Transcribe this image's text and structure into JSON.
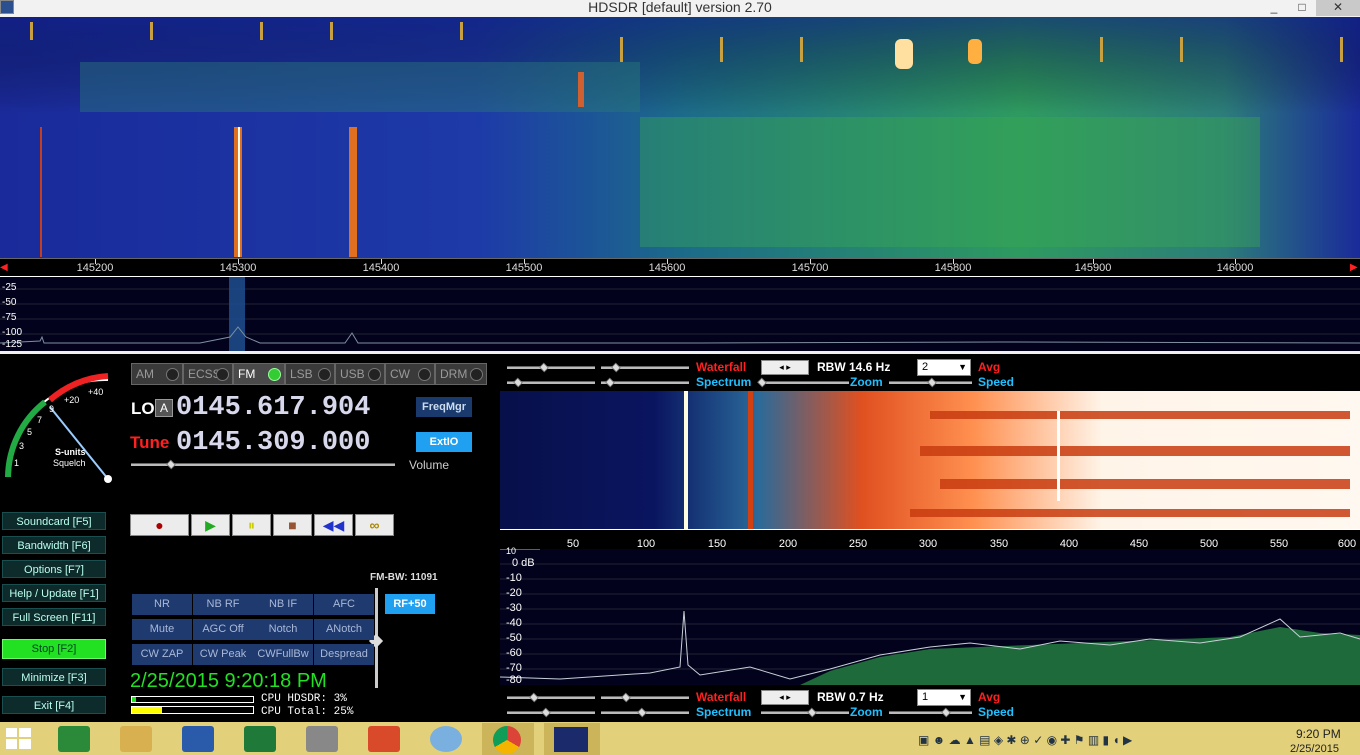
{
  "window": {
    "title": "HDSDR [default]  version 2.70",
    "min": "_",
    "max": "□",
    "close": "✕"
  },
  "freq_axis": {
    "labels": [
      "145200",
      "145300",
      "145400",
      "145500",
      "145600",
      "145700",
      "145800",
      "145900",
      "146000"
    ]
  },
  "spectrum_top": {
    "db_labels": [
      "-25",
      "-50",
      "-75",
      "-100",
      "-125"
    ]
  },
  "smeter": {
    "scale": [
      "1",
      "3",
      "5",
      "7",
      "9",
      "+20",
      "+40"
    ],
    "label1": "S-units",
    "label2": "Squelch"
  },
  "modes": [
    {
      "label": "AM",
      "active": false
    },
    {
      "label": "ECSS",
      "active": false
    },
    {
      "label": "FM",
      "active": true
    },
    {
      "label": "LSB",
      "active": false
    },
    {
      "label": "USB",
      "active": false
    },
    {
      "label": "CW",
      "active": false
    },
    {
      "label": "DRM",
      "active": false
    }
  ],
  "lo": {
    "label": "LO",
    "badge": "A",
    "value": "0145.617.904"
  },
  "tune": {
    "label": "Tune",
    "value": "0145.309.000"
  },
  "freqmgr": "FreqMgr",
  "extio": "ExtIO",
  "volume": "Volume",
  "left_buttons": [
    "Soundcard  [F5]",
    "Bandwidth  [F6]",
    "Options  [F7]",
    "Help / Update  [F1]",
    "Full Screen  [F11]",
    "Stop  [F2]",
    "Minimize  [F3]",
    "Exit  [F4]"
  ],
  "transport": [
    "●",
    "▶",
    "⏸",
    "■",
    "◀◀",
    "∞"
  ],
  "fm_bw": "FM-BW: 11091",
  "rf_btn": "RF+50",
  "dsp_buttons": [
    [
      "NR",
      "NB RF",
      "NB IF",
      "AFC"
    ],
    [
      "Mute",
      "AGC Off",
      "Notch",
      "ANotch"
    ],
    [
      "CW ZAP",
      "CW Peak",
      "CWFullBw",
      "Despread"
    ]
  ],
  "datetime": "2/25/2015 9:20:18 PM",
  "cpu": {
    "hdsdr": "CPU HDSDR: 3%",
    "total": "CPU Total: 25%"
  },
  "rf_panel": {
    "waterfall": "Waterfall",
    "spectrum": "Spectrum",
    "rbw": "RBW 14.6 Hz",
    "avg_value": "2",
    "avg": "Avg",
    "zoom": "Zoom",
    "speed": "Speed"
  },
  "af_panel": {
    "waterfall": "Waterfall",
    "spectrum": "Spectrum",
    "rbw": "RBW  0.7 Hz",
    "avg_value": "1",
    "avg": "Avg",
    "zoom": "Zoom",
    "speed": "Speed"
  },
  "zoom_axis": {
    "labels": [
      "50",
      "100",
      "150",
      "200",
      "250",
      "300",
      "350",
      "400",
      "450",
      "500",
      "550",
      "600"
    ]
  },
  "zoom_spec": {
    "db_labels": [
      "10",
      "0 dB",
      "-10",
      "-20",
      "-30",
      "-40",
      "-50",
      "-60",
      "-70",
      "-80"
    ]
  },
  "taskbar": {
    "time": "9:20 PM",
    "date": "2/25/2015"
  },
  "colors": {
    "lcd": "#d8d8ec",
    "accent_red": "#ff2020",
    "accent_cyan": "#20c0ff",
    "stop_green": "#22e022"
  }
}
